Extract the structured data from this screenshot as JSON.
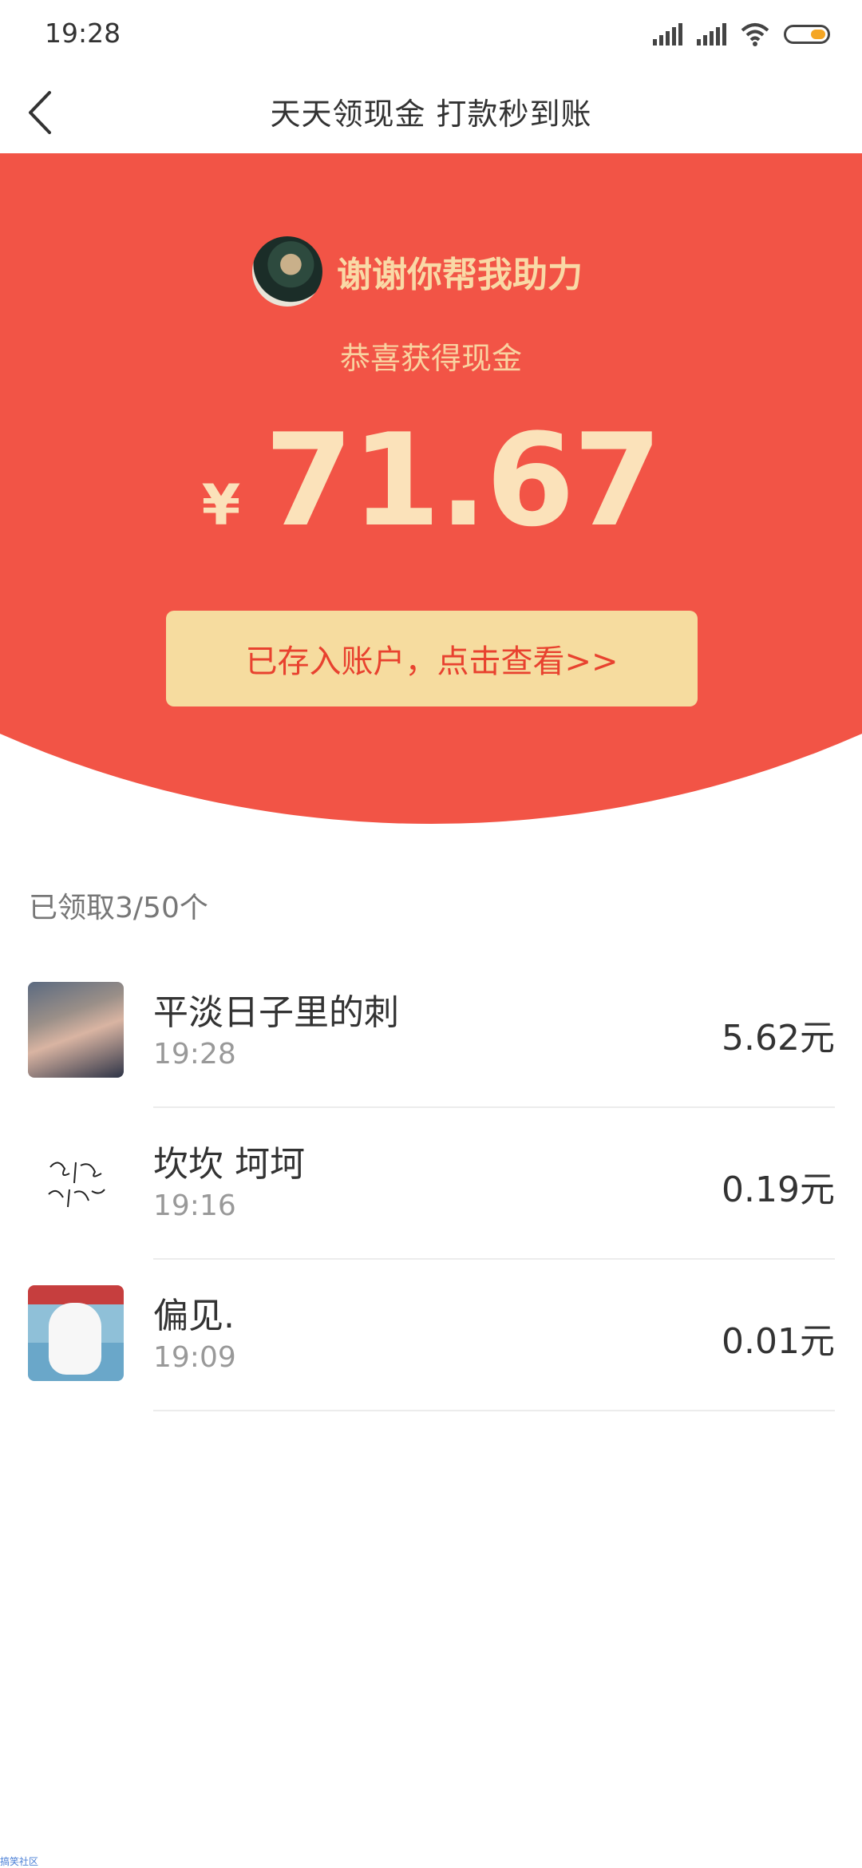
{
  "status_bar": {
    "time": "19:28"
  },
  "header": {
    "title": "天天领现金 打款秒到账"
  },
  "hero": {
    "thanks_text": "谢谢你帮我助力",
    "congrats_text": "恭喜获得现金",
    "currency_symbol": "¥",
    "amount": "71.67",
    "cta_label": "已存入账户，点击查看>>"
  },
  "list": {
    "count_text": "已领取3/50个",
    "items": [
      {
        "name": "平淡日子里的刺",
        "time": "19:28",
        "amount": "5.62元"
      },
      {
        "name": "坎坎 坷坷",
        "time": "19:16",
        "amount": "0.19元"
      },
      {
        "name": "偏见.",
        "time": "19:09",
        "amount": "0.01元"
      }
    ]
  },
  "watermark": "搞笑社区",
  "colors": {
    "primary_red": "#f25446",
    "gold_text": "#fbe2ba",
    "cta_bg": "#f6dc9f",
    "cta_text": "#e8422f"
  },
  "icons": {
    "back": "chevron-left-icon",
    "signal": "signal-icon",
    "wifi": "wifi-icon",
    "battery": "battery-icon"
  }
}
